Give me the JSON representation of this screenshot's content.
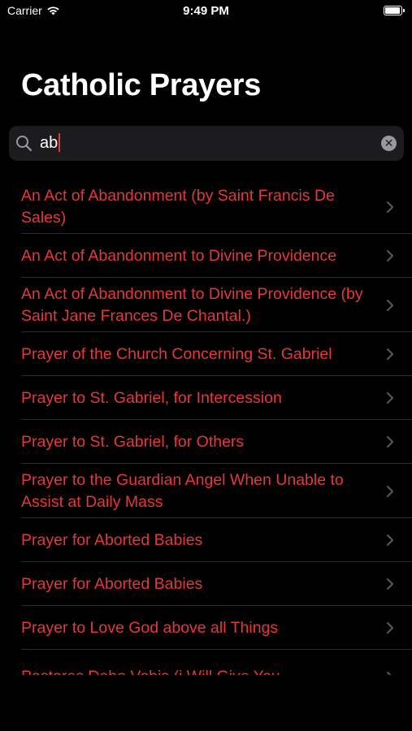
{
  "status_bar": {
    "carrier": "Carrier",
    "time": "9:49 PM",
    "wifi_icon": "wifi-icon",
    "battery_icon": "battery-icon"
  },
  "header": {
    "title": "Catholic Prayers"
  },
  "search": {
    "value": "ab",
    "search_icon": "search-icon",
    "clear_icon": "clear-icon"
  },
  "results": [
    {
      "title": "An Act of Abandonment (by Saint Francis De Sales)"
    },
    {
      "title": "An Act of Abandonment to Divine Providence"
    },
    {
      "title": "An Act of Abandonment to Divine Providence (by Saint Jane Frances De Chantal.)"
    },
    {
      "title": "Prayer of the Church Concerning St. Gabriel"
    },
    {
      "title": "Prayer to St. Gabriel, for Intercession"
    },
    {
      "title": "Prayer to St. Gabriel, for Others"
    },
    {
      "title": "Prayer to the Guardian Angel When Unable to Assist at Daily Mass"
    },
    {
      "title": "Prayer for Aborted Babies"
    },
    {
      "title": "Prayer for Aborted Babies"
    },
    {
      "title": "Prayer to Love God above all Things"
    },
    {
      "title": "Pastores Dabo Vobis (i Will Give You"
    }
  ],
  "colors": {
    "background": "#000000",
    "accent": "#e5383b",
    "search_field": "#1c1c1e",
    "separator": "#2c2c2e",
    "chevron": "#5a5a5e"
  }
}
